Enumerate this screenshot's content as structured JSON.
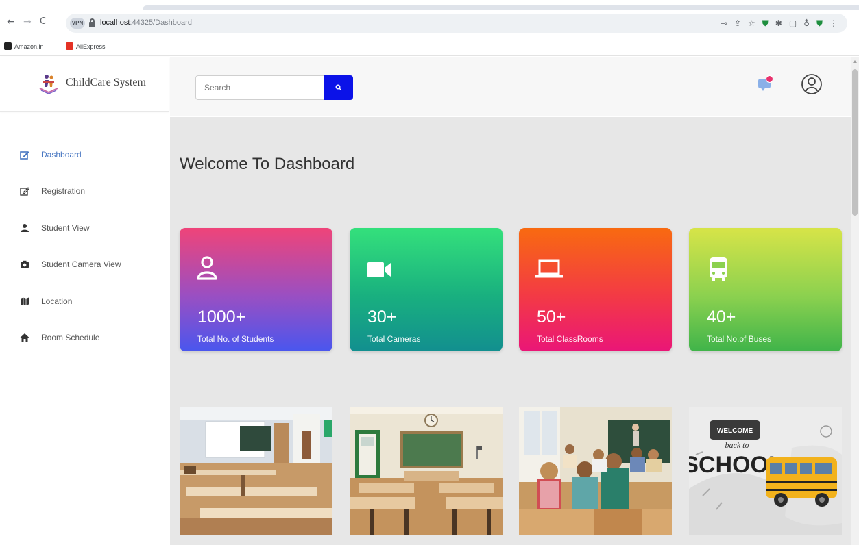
{
  "browser": {
    "site_chip": "VPN",
    "url_host": "localhost",
    "url_path": ":44325/Dashboard",
    "bookmarks": [
      {
        "label": "Amazon.in",
        "icon": "amazon-icon"
      },
      {
        "label": "AliExpress",
        "icon": "aliexpress-icon"
      }
    ],
    "nav_glyphs": {
      "back": "←",
      "forward": "→",
      "reload": "C"
    }
  },
  "app": {
    "brand": "ChildCare System",
    "search": {
      "placeholder": "Search",
      "value": ""
    },
    "nav": [
      {
        "label": "Dashboard",
        "icon": "edit-icon",
        "active": true
      },
      {
        "label": "Registration",
        "icon": "register-icon",
        "active": false
      },
      {
        "label": "Student View",
        "icon": "user-icon",
        "active": false
      },
      {
        "label": "Student Camera View",
        "icon": "camera-icon",
        "active": false
      },
      {
        "label": "Location",
        "icon": "map-icon",
        "active": false
      },
      {
        "label": "Room Schedule",
        "icon": "home-icon",
        "active": false
      }
    ],
    "welcome": "Welcome To Dashboard",
    "cards": [
      {
        "value": "1000+",
        "label": "Total No. of Students",
        "icon": "student-icon"
      },
      {
        "value": "30+",
        "label": "Total Cameras",
        "icon": "video-camera-icon"
      },
      {
        "value": "50+",
        "label": "Total ClassRooms",
        "icon": "laptop-icon"
      },
      {
        "value": "40+",
        "label": "Total No.of Buses",
        "icon": "bus-icon"
      }
    ],
    "photos": [
      {
        "name": "empty-classroom-photo"
      },
      {
        "name": "chalkboard-classroom-photo"
      },
      {
        "name": "students-classroom-photo"
      },
      {
        "name": "welcome-back-to-school-photo",
        "text_lines": [
          "WELCOME",
          "back to",
          "SCHOOL"
        ]
      }
    ]
  },
  "colors": {
    "active_nav": "#4a78c2",
    "search_button": "#0b12e8",
    "notification_dot": "#e8336e"
  }
}
